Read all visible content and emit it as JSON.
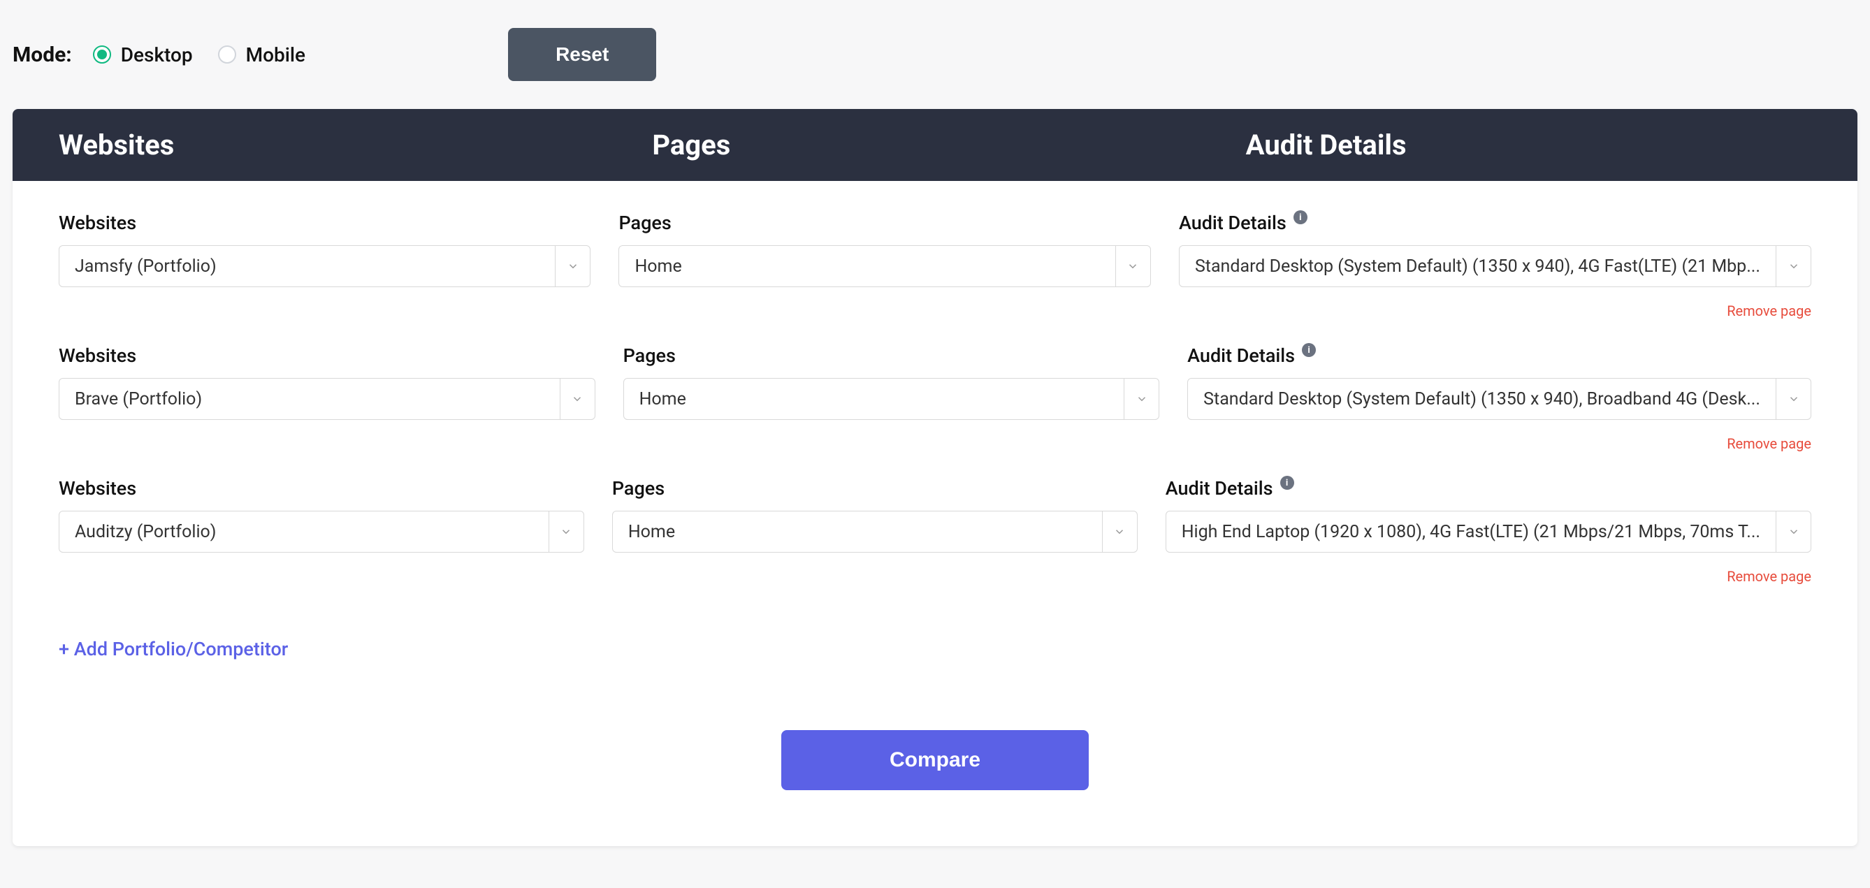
{
  "mode": {
    "label": "Mode:",
    "options": [
      {
        "label": "Desktop",
        "selected": true
      },
      {
        "label": "Mobile",
        "selected": false
      }
    ],
    "reset_label": "Reset"
  },
  "headers": {
    "websites": "Websites",
    "pages": "Pages",
    "audit": "Audit Details"
  },
  "labels": {
    "websites": "Websites",
    "pages": "Pages",
    "audit": "Audit Details",
    "remove": "Remove page",
    "add": "+ Add Portfolio/Competitor",
    "compare": "Compare"
  },
  "rows": [
    {
      "website": "Jamsfy (Portfolio)",
      "page": "Home",
      "audit": "Standard Desktop (System Default) (1350 x 940), 4G Fast(LTE) (21 Mbp..."
    },
    {
      "website": "Brave (Portfolio)",
      "page": "Home",
      "audit": "Standard Desktop (System Default) (1350 x 940), Broadband 4G (Desk..."
    },
    {
      "website": "Auditzy (Portfolio)",
      "page": "Home",
      "audit": "High End Laptop (1920 x 1080), 4G Fast(LTE) (21 Mbps/21 Mbps, 70ms T..."
    }
  ]
}
